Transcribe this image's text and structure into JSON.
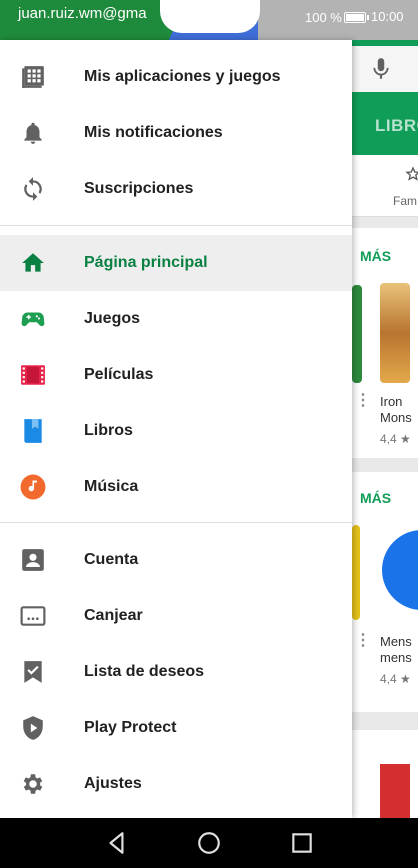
{
  "status_bar": {
    "account_email": "juan.ruiz.wm@gma",
    "battery": "100 %",
    "time": "10:00"
  },
  "drawer": {
    "section1": [
      {
        "label": "Mis aplicaciones y juegos",
        "icon": "apps-grid-icon"
      },
      {
        "label": "Mis notificaciones",
        "icon": "bell-icon"
      },
      {
        "label": "Suscripciones",
        "icon": "refresh-icon"
      }
    ],
    "section2": [
      {
        "label": "Página principal",
        "icon": "home-icon",
        "active": true
      },
      {
        "label": "Juegos",
        "icon": "gamepad-icon"
      },
      {
        "label": "Películas",
        "icon": "film-icon"
      },
      {
        "label": "Libros",
        "icon": "book-icon"
      },
      {
        "label": "Música",
        "icon": "music-icon"
      }
    ],
    "section3": [
      {
        "label": "Cuenta",
        "icon": "account-icon"
      },
      {
        "label": "Canjear",
        "icon": "redeem-icon"
      },
      {
        "label": "Lista de deseos",
        "icon": "wishlist-icon"
      },
      {
        "label": "Play Protect",
        "icon": "shield-play-icon"
      },
      {
        "label": "Ajustes",
        "icon": "gear-icon"
      }
    ]
  },
  "background": {
    "tab_label": "LIBRO",
    "chip_label": "Fam",
    "more_label_1": "MÁS",
    "more_label_2": "MÁS",
    "app1_name_line1": "Iron",
    "app1_name_line2": "Mons",
    "app1_rating": "4,4 ★",
    "app2_name_line1": "Mens",
    "app2_name_line2": "mens",
    "app2_rating": "4,4 ★"
  },
  "colors": {
    "accent_green": "#0b8043",
    "header_green": "#0f9d58",
    "games_green": "#1e9e51",
    "movies_red": "#e8234a",
    "books_blue": "#1a8ae5",
    "music_orange": "#f2692d"
  },
  "nav_bar": [
    "back-icon",
    "home-circle-icon",
    "recents-icon"
  ]
}
